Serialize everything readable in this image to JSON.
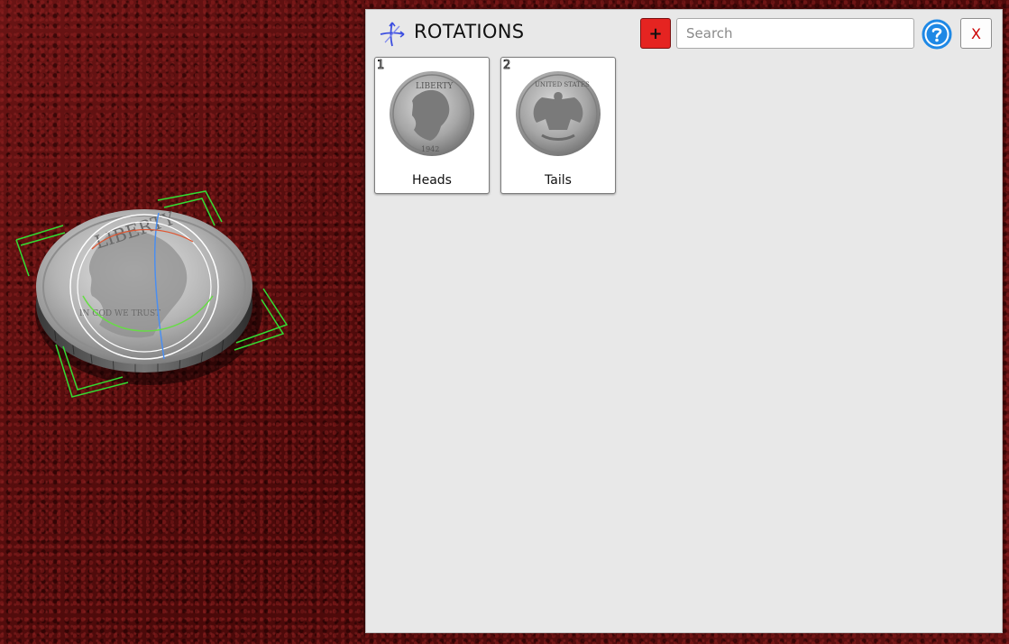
{
  "panel": {
    "title": "ROTATIONS",
    "icon": "rotate-axes-icon",
    "add_label": "+",
    "search": {
      "placeholder": "Search",
      "value": ""
    },
    "help_icon": "help-question-icon",
    "close_label": "X"
  },
  "rotations": [
    {
      "index": "1",
      "label": "Heads",
      "thumbnail": "coin-heads-thumbnail"
    },
    {
      "index": "2",
      "label": "Tails",
      "thumbnail": "coin-tails-thumbnail"
    }
  ],
  "scene": {
    "object": "quarter-coin",
    "background": "red-felt-table"
  },
  "colors": {
    "add_button": "#e52421",
    "help_icon": "#1e88e5",
    "close_text": "#cc0000",
    "rotation_gizmo": "#33dd33",
    "panel_bg": "#e8e8e8"
  }
}
